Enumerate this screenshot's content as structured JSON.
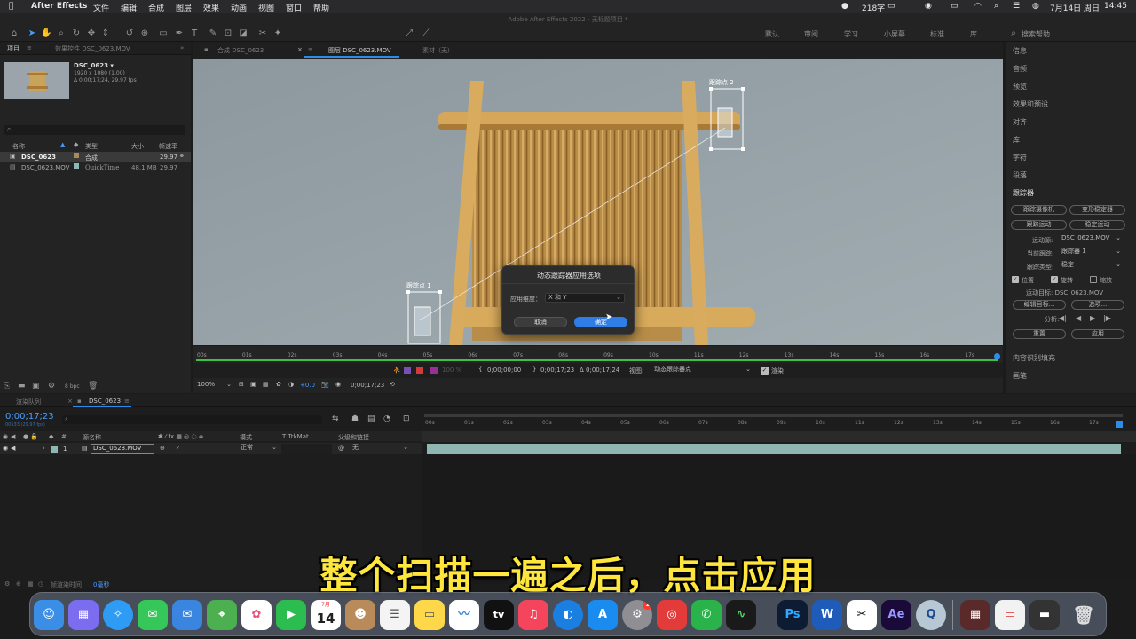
{
  "menubar": {
    "app_name": "After Effects",
    "items": [
      "文件",
      "编辑",
      "合成",
      "图层",
      "效果",
      "动画",
      "视图",
      "窗口",
      "帮助"
    ],
    "word_count": "218字",
    "datetime": "7月14日 周日",
    "time": "14:45"
  },
  "window_title": "Adobe After Effects 2022 - 无标题项目 *",
  "toolbar": {
    "align_label": "对齐",
    "workspaces": [
      "默认",
      "审阅",
      "学习",
      "小屏幕",
      "标准",
      "库"
    ],
    "search_placeholder": "搜索帮助"
  },
  "project_panel": {
    "tab_project": "项目",
    "tab_effects": "效果控件 DSC_0623.MOV",
    "thumb_name": "DSC_0623 ▾",
    "thumb_info1": "1920 x 1080 (1.00)",
    "thumb_info2": "Δ 0;00;17;24, 29.97 fps",
    "col_name": "名称",
    "col_type": "类型",
    "col_size": "大小",
    "col_fps": "帧速率",
    "rows": [
      {
        "name": "DSC_0623",
        "type": "合成",
        "size": "",
        "fps": "29.97"
      },
      {
        "name": "DSC_0623.MOV",
        "type": "QuickTime",
        "size": "48.1 MB",
        "fps": "29.97"
      }
    ],
    "bpc": "8 bpc"
  },
  "viewer_tabs": {
    "comp": "合成 DSC_0623",
    "layer": "图层 DSC_0623.MOV",
    "footage": "素材（无）"
  },
  "tracker_labels": {
    "point1": "跟踪点 1",
    "point2": "跟踪点 2"
  },
  "dialog": {
    "title": "动态跟踪器应用选项",
    "apply_label": "应用维度：",
    "apply_value": "X 和 Y",
    "cancel": "取消",
    "ok": "确定"
  },
  "ruler_ticks": [
    "00s",
    "01s",
    "02s",
    "03s",
    "04s",
    "05s",
    "06s",
    "07s",
    "08s",
    "09s",
    "10s",
    "11s",
    "12s",
    "13s",
    "14s",
    "15s",
    "16s",
    "17s"
  ],
  "viewer_footer": {
    "in_time": "0;00;00;00",
    "out_time": "0;00;17;23",
    "dur_time": "Δ 0;00;17;24",
    "view_label": "视图:",
    "view_value": "动态跟踪器点",
    "render_label": "渲染",
    "zoom": "100%",
    "offset": "+0.0",
    "timecode": "0;00;17;23",
    "opacity": "100 %"
  },
  "right_panel": {
    "items": [
      "信息",
      "音频",
      "预览",
      "效果和预设",
      "对齐",
      "库",
      "字符",
      "段落"
    ],
    "tracker_title": "跟踪器",
    "btn_track_camera": "跟踪摄像机",
    "btn_warp_stabilizer": "变形稳定器",
    "btn_track_motion": "跟踪运动",
    "btn_stabilize_motion": "稳定运动",
    "motion_source_label": "运动源:",
    "motion_source_value": "DSC_0623.MOV",
    "current_track_label": "当前跟踪:",
    "current_track_value": "跟踪器 1",
    "track_type_label": "跟踪类型:",
    "track_type_value": "稳定",
    "cb_position": "位置",
    "cb_rotation": "旋转",
    "cb_scale": "缩放",
    "target_label": "运动目标: DSC_0623.MOV",
    "btn_edit_target": "编辑目标...",
    "btn_options": "选项...",
    "analyze_label": "分析:",
    "btn_reset": "重置",
    "btn_apply": "应用",
    "content_fill": "内容识别填充",
    "brush": "画笔"
  },
  "timeline": {
    "tab_render": "渲染队列",
    "tab_comp": "DSC_0623",
    "timecode": "0;00;17;23",
    "timecode_sub": "00533 (29.97 fps)",
    "col_num": "#",
    "col_source": "源名称",
    "col_mode": "模式",
    "col_trkmat": "T  TrkMat",
    "col_parent": "父级和链接",
    "layer_num": "1",
    "layer_name": "DSC_0623.MOV",
    "layer_mode": "正常",
    "layer_parent": "无",
    "ticks": [
      "00s",
      "01s",
      "02s",
      "03s",
      "04s",
      "05s",
      "06s",
      "07s",
      "08s",
      "09s",
      "10s",
      "11s",
      "12s",
      "13s",
      "14s",
      "15s",
      "16s",
      "17s"
    ],
    "render_time_label": "帧渲染时间",
    "render_time_value": "0毫秒"
  },
  "subtitle": "整个扫描一遍之后，点击应用",
  "dock": {
    "calendar_month": "7月",
    "calendar_day": "14",
    "appstore_badge": "1",
    "app_labels": [
      "tv",
      "Ps",
      "W",
      "Ae"
    ]
  },
  "colors": {
    "accent_blue": "#2d8ceb",
    "ok_button": "#2f7ee8",
    "subtitle_yellow": "#ffe63d",
    "layer_bar": "#8fb7b2",
    "green_playhead": "#3fbf4a"
  }
}
